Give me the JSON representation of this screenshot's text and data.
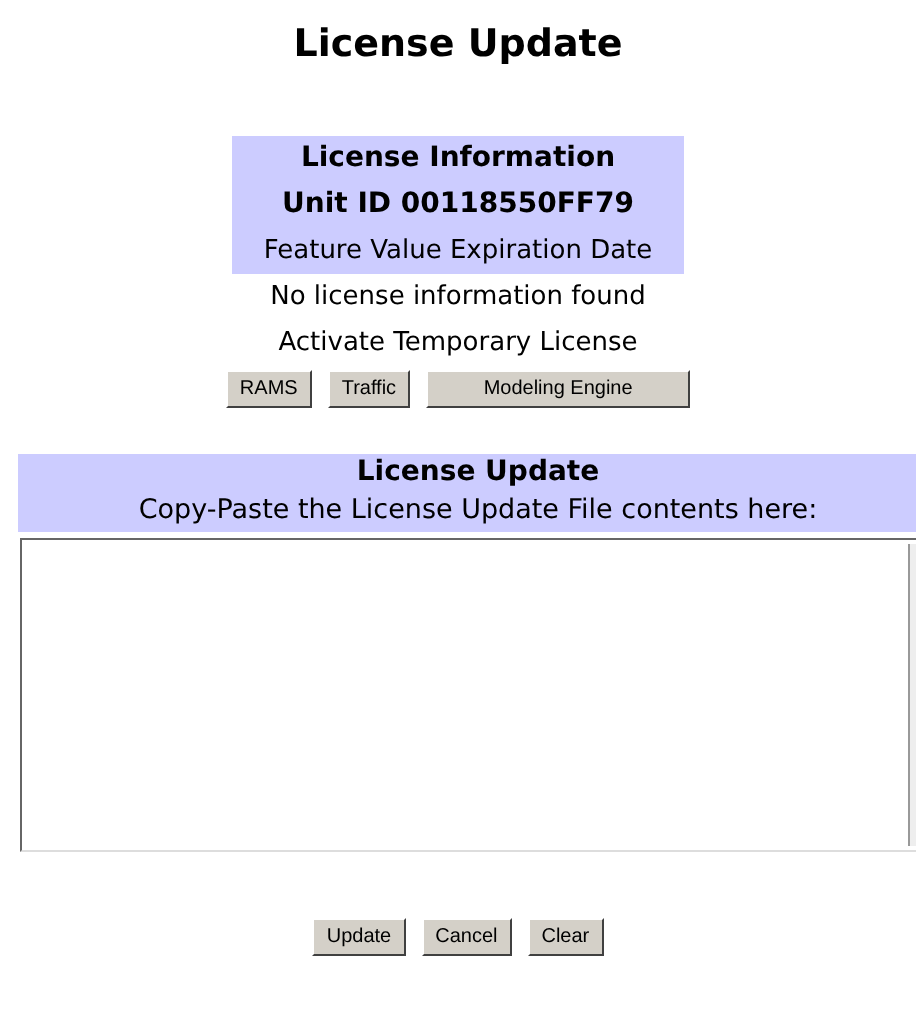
{
  "title": "License Update",
  "license_info": {
    "heading": "License Information",
    "unit_id": "Unit ID 00118550FF79",
    "columns_header": "Feature Value Expiration Date",
    "message": "No license information found",
    "activate_label": "Activate Temporary License",
    "buttons": [
      "RAMS",
      "Traffic",
      "Modeling Engine"
    ]
  },
  "license_update": {
    "heading": "License Update",
    "instructions": "Copy-Paste the License Update File contents here:"
  },
  "buttons": [
    "Update",
    "Cancel",
    "Clear"
  ]
}
